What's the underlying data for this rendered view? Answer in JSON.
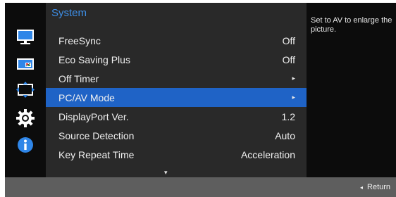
{
  "menu": {
    "title": "System",
    "items": [
      {
        "label": "FreeSync",
        "value": "Off"
      },
      {
        "label": "Eco Saving Plus",
        "value": "Off"
      },
      {
        "label": "Off Timer",
        "value": "▸"
      },
      {
        "label": "PC/AV Mode",
        "value": "▸",
        "selected": true
      },
      {
        "label": "DisplayPort Ver.",
        "value": "1.2"
      },
      {
        "label": "Source Detection",
        "value": "Auto"
      },
      {
        "label": "Key Repeat Time",
        "value": "Acceleration"
      }
    ],
    "scroll_indicator": "▾"
  },
  "help": {
    "text": "Set to AV to enlarge the picture."
  },
  "bottom_bar": {
    "return_arrow": "◂",
    "return_label": "Return"
  },
  "side_icons": [
    "picture-icon",
    "color-icon",
    "size-position-icon",
    "system-gear-icon",
    "info-icon"
  ],
  "colors": {
    "accent_title": "#3d8fe8",
    "selected_row": "#1f63c6",
    "menu_bg": "#292929",
    "rail_bg": "#0c0c0c",
    "bottom_bar": "#5e5e5e"
  }
}
